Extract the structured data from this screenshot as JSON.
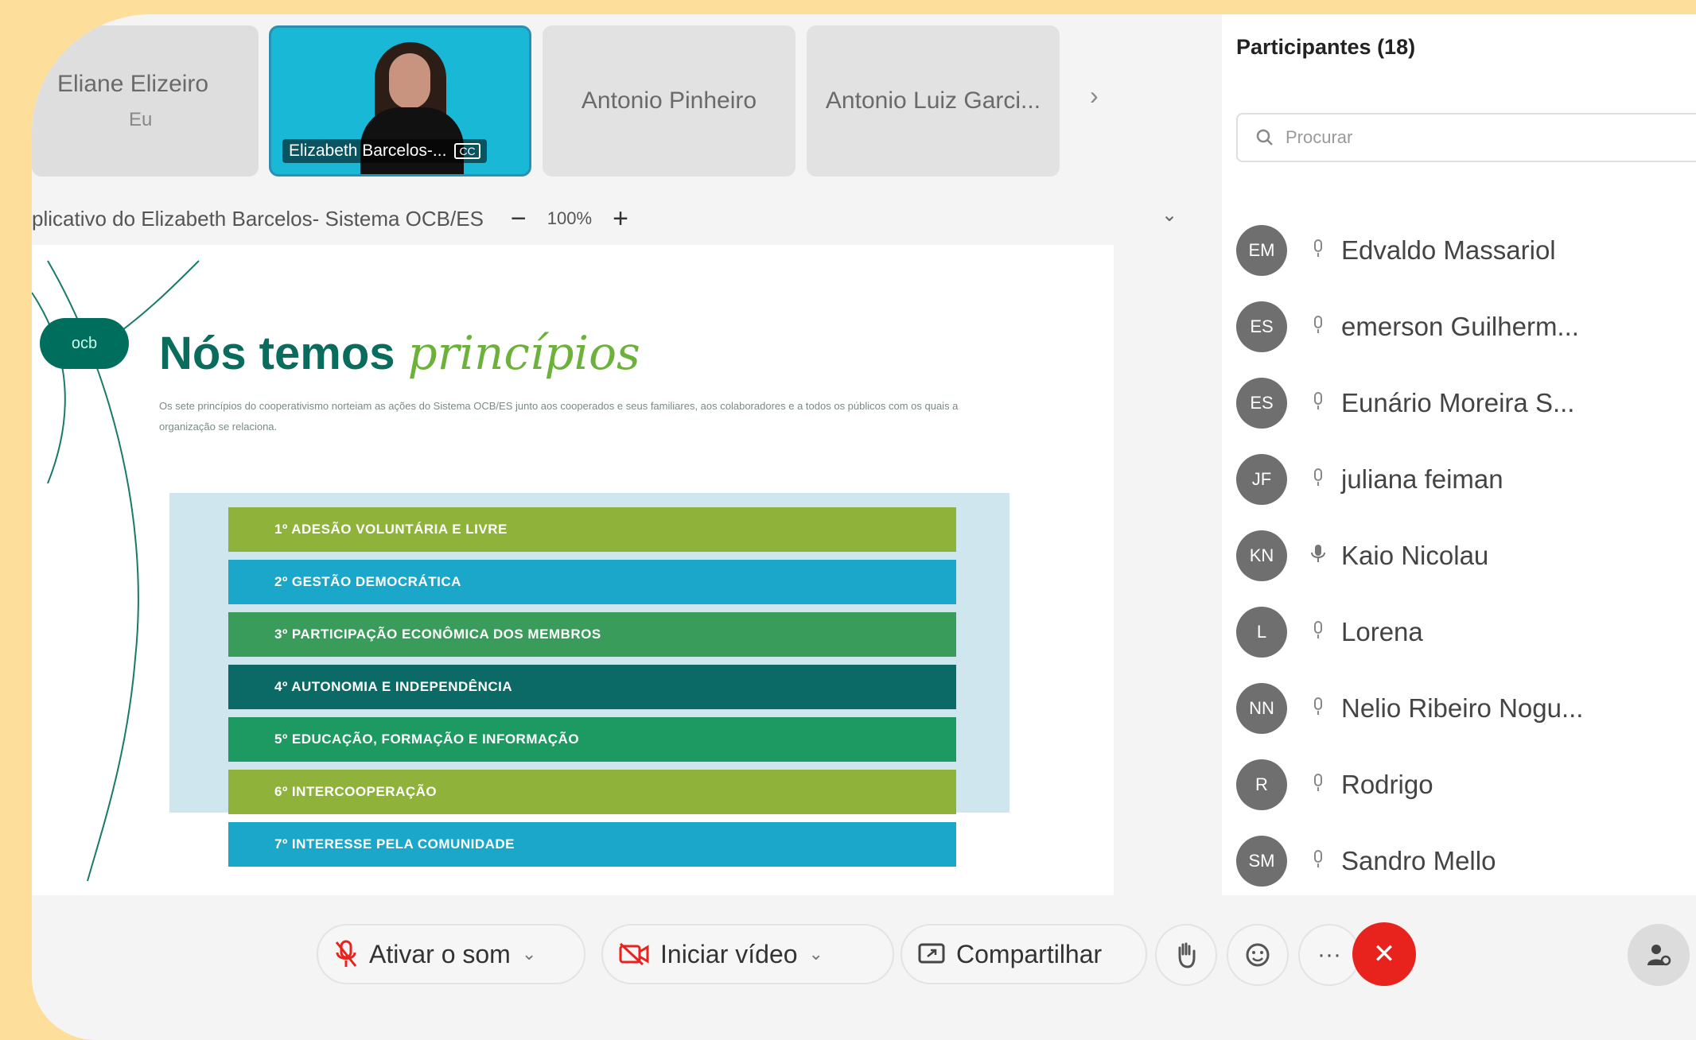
{
  "video_strip": {
    "tiles": [
      {
        "name": "Eliane Elizeiro",
        "sub": "Eu"
      },
      {
        "name": "Elizabeth Barcelos-...",
        "tag": "CC"
      },
      {
        "name": "Antonio Pinheiro"
      },
      {
        "name": "Antonio Luiz Garci..."
      }
    ],
    "next_icon": "›"
  },
  "share_bar": {
    "title": "plicativo do Elizabeth Barcelos- Sistema OCB/ES",
    "zoom_minus": "−",
    "zoom_value": "100%",
    "zoom_plus": "+",
    "menu_icon": "⌄"
  },
  "slide": {
    "logo": "ocb",
    "title_bold": "Nós temos",
    "title_accent": "princípios",
    "description": "Os sete princípios do cooperativismo norteiam as ações do Sistema OCB/ES junto aos cooperados e seus familiares, aos colaboradores e a todos os públicos com os quais a organização se relaciona.",
    "principles": [
      {
        "label": "1º ADESÃO VOLUNTÁRIA E LIVRE",
        "color": "#8fb33a"
      },
      {
        "label": "2º GESTÃO DEMOCRÁTICA",
        "color": "#1aa7c9"
      },
      {
        "label": "3º PARTICIPAÇÃO ECONÔMICA DOS MEMBROS",
        "color": "#3a9c5a"
      },
      {
        "label": "4º AUTONOMIA E INDEPENDÊNCIA",
        "color": "#0b6a66"
      },
      {
        "label": "5º EDUCAÇÃO, FORMAÇÃO E INFORMAÇÃO",
        "color": "#1d9a62"
      },
      {
        "label": "6º INTERCOOPERAÇÃO",
        "color": "#8fb33a"
      },
      {
        "label": "7º INTERESSE PELA COMUNIDADE",
        "color": "#1aa7c9"
      }
    ]
  },
  "participants": {
    "title": "Participantes (18)",
    "search_placeholder": "Procurar",
    "list": [
      {
        "initials": "EM",
        "name": "Edvaldo Massariol",
        "mic": "mic-muted"
      },
      {
        "initials": "ES",
        "name": "emerson Guilherm...",
        "mic": "mic-muted"
      },
      {
        "initials": "ES",
        "name": "Eunário Moreira S...",
        "mic": "mic-muted"
      },
      {
        "initials": "JF",
        "name": "juliana feiman",
        "mic": "mic-muted"
      },
      {
        "initials": "KN",
        "name": "Kaio Nicolau",
        "mic": "mic-active"
      },
      {
        "initials": "L",
        "name": "Lorena",
        "mic": "mic-muted"
      },
      {
        "initials": "NN",
        "name": "Nelio Ribeiro Nogu...",
        "mic": "mic-muted"
      },
      {
        "initials": "R",
        "name": "Rodrigo",
        "mic": "mic-muted"
      },
      {
        "initials": "SM",
        "name": "Sandro Mello",
        "mic": "mic-muted"
      }
    ]
  },
  "controls": {
    "audio_label": "Ativar o som",
    "video_label": "Iniciar vídeo",
    "share_label": "Compartilhar",
    "chevron": "⌄",
    "more": "···",
    "end": "✕"
  },
  "colors": {
    "frame": "#FDDF9B",
    "title_green": "#0a6c5c",
    "accent_green": "#6cb23a",
    "end_red": "#e8231e"
  }
}
